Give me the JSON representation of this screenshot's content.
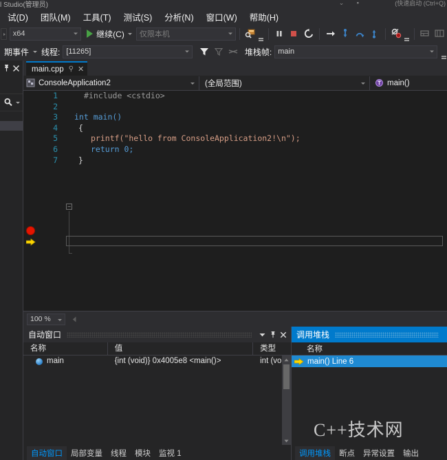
{
  "window": {
    "title_fragment": "l Studio(管理员)",
    "search_hint_fragment": "(快速启动 (Ctrl+Q)"
  },
  "menu": {
    "items": [
      {
        "label": "试(D)",
        "name": "menu-debug"
      },
      {
        "label": "团队(M)",
        "name": "menu-team"
      },
      {
        "label": "工具(T)",
        "name": "menu-tools"
      },
      {
        "label": "测试(S)",
        "name": "menu-test"
      },
      {
        "label": "分析(N)",
        "name": "menu-analyze"
      },
      {
        "label": "窗口(W)",
        "name": "menu-window"
      },
      {
        "label": "帮助(H)",
        "name": "menu-help"
      }
    ]
  },
  "toolbar": {
    "platform": "x64",
    "continue_label": "继续(C)",
    "debugger_type": "仅限本机",
    "lifecycle_events": "期事件",
    "thread_label": "线程:",
    "thread_value": "[11265]",
    "frame_label": "堆栈帧:",
    "frame_value": "main",
    "icons": [
      {
        "name": "attach-process-icon"
      },
      {
        "name": "pause-icon"
      },
      {
        "name": "stop-icon"
      },
      {
        "name": "restart-icon"
      },
      {
        "name": "show-next-statement-icon"
      },
      {
        "name": "step-into-icon"
      },
      {
        "name": "step-over-icon"
      },
      {
        "name": "step-out-icon"
      },
      {
        "name": "breakpoint-disable-icon"
      },
      {
        "name": "memory-window-icon"
      },
      {
        "name": "threads-window-icon"
      }
    ]
  },
  "editor": {
    "tab_label": "main.cpp",
    "nav_project": "ConsoleApplication2",
    "nav_scope": "(全局范围)",
    "nav_member": "main()",
    "zoom_level": "100 %",
    "lines": [
      {
        "n": "1",
        "text": "#include <cstdio>",
        "kind": "pp"
      },
      {
        "n": "2",
        "text": "",
        "kind": "plain"
      },
      {
        "n": "3",
        "text": "int main()",
        "kind": "sig"
      },
      {
        "n": "4",
        "text": "{",
        "kind": "plain"
      },
      {
        "n": "5",
        "text": "printf(\"hello from ConsoleApplication2!\\n\");",
        "kind": "call"
      },
      {
        "n": "6",
        "text": "return 0;",
        "kind": "ret"
      },
      {
        "n": "7",
        "text": "}",
        "kind": "plain"
      }
    ],
    "breakpoint_line": "5",
    "current_line": "6"
  },
  "autos_panel": {
    "title": "自动窗口",
    "columns": [
      "名称",
      "值",
      "类型"
    ],
    "rows": [
      {
        "name": "main",
        "value": "{int (void)} 0x4005e8 <main()>",
        "type": "int (void"
      }
    ],
    "tabs": [
      {
        "label": "自动窗口",
        "selected": true
      },
      {
        "label": "局部变量",
        "selected": false
      },
      {
        "label": "线程",
        "selected": false
      },
      {
        "label": "模块",
        "selected": false
      },
      {
        "label": "监视 1",
        "selected": false
      }
    ]
  },
  "callstack_panel": {
    "title": "调用堆栈",
    "column": "名称",
    "rows": [
      {
        "label": "main() Line 6",
        "current": true
      }
    ],
    "tabs": [
      {
        "label": "调用堆栈",
        "selected": true
      },
      {
        "label": "断点",
        "selected": false
      },
      {
        "label": "异常设置",
        "selected": false
      },
      {
        "label": "输出",
        "selected": false
      }
    ]
  },
  "watermark": "C++技术网",
  "colors": {
    "accent": "#007acc",
    "breakpoint": "#e51400",
    "current_statement": "#ffd700",
    "editor_bg": "#1e1e1e",
    "chrome_bg": "#2d2d30",
    "panel_bg": "#252526"
  }
}
